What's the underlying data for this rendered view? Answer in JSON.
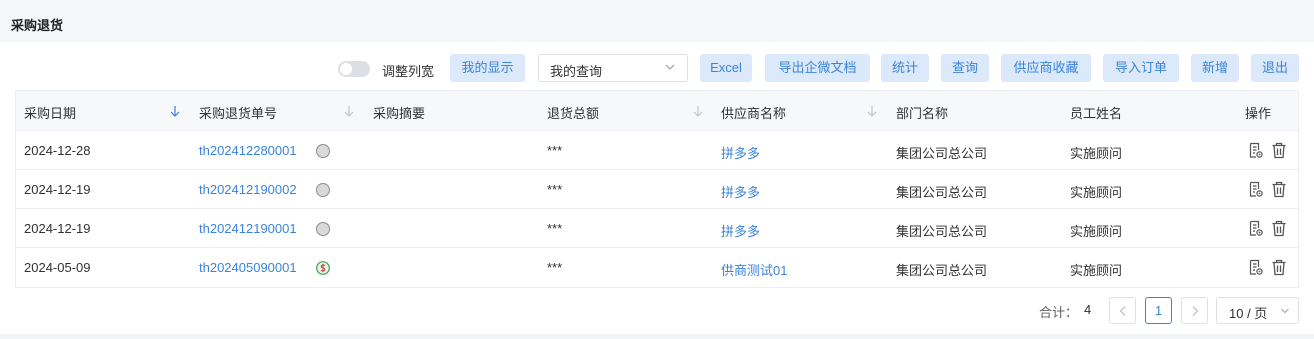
{
  "page": {
    "title": "采购退货"
  },
  "toolbar": {
    "toggle_label": "调整列宽",
    "toggle_on": false,
    "my_display": "我的显示",
    "query_select_value": "我的查询",
    "excel": "Excel",
    "export_wecom": "导出企微文档",
    "stats": "统计",
    "query": "查询",
    "supplier_fav": "供应商收藏",
    "import_order": "导入订单",
    "add": "新增",
    "exit": "退出"
  },
  "table": {
    "columns": [
      "采购日期",
      "采购退货单号",
      "采购摘要",
      "退货总额",
      "供应商名称",
      "部门名称",
      "员工姓名",
      "操作"
    ],
    "rows": [
      {
        "date": "2024-12-28",
        "order_no": "th202412280001",
        "status_icon": "pending-circle-icon",
        "summary": "",
        "total": "***",
        "supplier": "拼多多",
        "department": "集团公司总公司",
        "employee": "实施顾问"
      },
      {
        "date": "2024-12-19",
        "order_no": "th202412190002",
        "status_icon": "pending-circle-icon",
        "summary": "",
        "total": "***",
        "supplier": "拼多多",
        "department": "集团公司总公司",
        "employee": "实施顾问"
      },
      {
        "date": "2024-12-19",
        "order_no": "th202412190001",
        "status_icon": "pending-circle-icon",
        "summary": "",
        "total": "***",
        "supplier": "拼多多",
        "department": "集团公司总公司",
        "employee": "实施顾问"
      },
      {
        "date": "2024-05-09",
        "order_no": "th202405090001",
        "status_icon": "paid-dollar-icon",
        "summary": "",
        "total": "***",
        "supplier": "供商测试01",
        "department": "集团公司总公司",
        "employee": "实施顾问"
      }
    ]
  },
  "pagination": {
    "total_label": "合计：",
    "total": "4",
    "current_page": "1",
    "page_size": "10 / 页"
  },
  "colors": {
    "accent": "#3a84d9",
    "button_bg": "#dbe9fb",
    "header_bg": "#f7f8fa"
  }
}
